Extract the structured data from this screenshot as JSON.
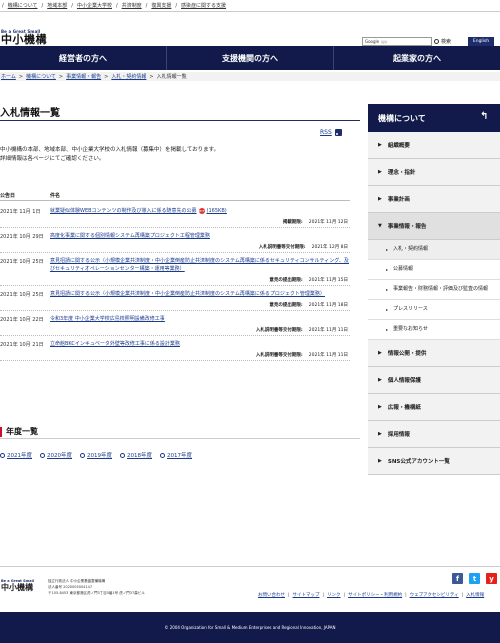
{
  "topbar": {
    "links": [
      "機構について",
      "地域本部",
      "中小企業大学校",
      "共済制度",
      "復興支援",
      "感染症に関する支援"
    ]
  },
  "header": {
    "logo_tag": "Be a Great Small",
    "logo_name": "中小機構",
    "search_label": "Google",
    "search_placeholder": "提供",
    "search_button": "検索",
    "english_button": "English"
  },
  "mainnav": {
    "items": [
      "経営者の方へ",
      "支援機関の方へ",
      "起業家の方へ"
    ]
  },
  "breadcrumb": {
    "items": [
      "ホーム",
      "機構について",
      "事業情報・報告",
      "入札・契約情報"
    ],
    "current": "入札情報一覧"
  },
  "page": {
    "title": "入札情報一覧",
    "rss_label": "RSS",
    "intro_line1": "中小機構の本部、地域本部、中小企業大学校の入札情報（募集中）を掲載しております。",
    "intro_line2": "詳細情報は各ページにてご確認ください。"
  },
  "table": {
    "col_date": "公告日",
    "col_name": "件名",
    "rows": [
      {
        "date": "2021年 11月 1日",
        "title": "就業疑似体験WEBコンテンツの制作及び導入に係る随意先の公募",
        "pdf": "PDF",
        "size": "(165KB)",
        "sub_label": "掲載期限:",
        "sub_value": "2021年 11月 12日"
      },
      {
        "date": "2021年 10月 29日",
        "title": "高度化事業に関する個別情報システム再構築プロジェクト工程管理業務",
        "sub_label": "入札説明書等交付期限:",
        "sub_value": "2021年 12月 8日"
      },
      {
        "date": "2021年 10月 25日",
        "title": "意見招請に関する公示（小規模企業共済制度・中小企業倒産防止共済制度のシステム再構築に係るセキュリティコンサルティング、及びセキュリティオペレーションセンター構築・運用等業務）",
        "sub_label": "意見の提出期限:",
        "sub_value": "2021年 11月 15日"
      },
      {
        "date": "2021年 10月 25日",
        "title": "意見招請に関する公示（小規模企業共済制度・中小企業倒産防止共済制度のシステム再構築に係るプロジェクト管理業務）",
        "sub_label": "意見の提出期限:",
        "sub_value": "2021年 11月 18日"
      },
      {
        "date": "2021年 10月 22日",
        "title": "令和3年度 中小企業大学校広島校照明設備改修工事",
        "sub_label": "入札説明書等交付期限:",
        "sub_value": "2021年 11月 11日"
      },
      {
        "date": "2021年 10月 21日",
        "title": "立命館BKCインキュベータ外壁等改修工事に係る設計業務",
        "sub_label": "入札説明書等交付期限:",
        "sub_value": "2021年 11月 11日"
      }
    ]
  },
  "years": {
    "title": "年度一覧",
    "items": [
      "2021年度",
      "2020年度",
      "2019年度",
      "2018年度",
      "2017年度"
    ]
  },
  "sidebar": {
    "title": "機構について",
    "items_before": [
      "組織概要",
      "理念・指針",
      "事業計画"
    ],
    "open_item": "事業情報・報告",
    "sub_items": [
      "入札・契約情報",
      "公募情報",
      "事業報告・財務情報・評価及び監査の情報",
      "プレスリリース",
      "重要なお知らせ"
    ],
    "items_after": [
      "情報公開・提供",
      "個人情報保護",
      "広報・機構紙",
      "採用情報",
      "SNS公式アカウント一覧"
    ]
  },
  "footer": {
    "logo_tag": "Be a Great Small",
    "logo_name": "中小機構",
    "addr_line1": "独立行政法人 中小企業基盤整備機構",
    "addr_line2": "法人番号 2020005004147",
    "addr_line3": "〒105-8453 東京都港区虎ノ門3丁目5番1号 虎ノ門37森ビル",
    "social": [
      "f",
      "t",
      "y"
    ],
    "links": [
      "お問い合わせ",
      "サイトマップ",
      "リンク",
      "サイトポリシー・利用規約",
      "ウェブアクセシビリティ",
      "入札情報"
    ],
    "copyright": "© 2004 Organization for Small & Medium Enterprises and Regional Innovation, JAPAN"
  },
  "colors": {
    "navy": "#111a4a",
    "accent_red": "#c8102e",
    "link": "#1a3a8c",
    "facebook": "#3b5998",
    "twitter": "#1da1f2",
    "youtube": "#e62117"
  }
}
